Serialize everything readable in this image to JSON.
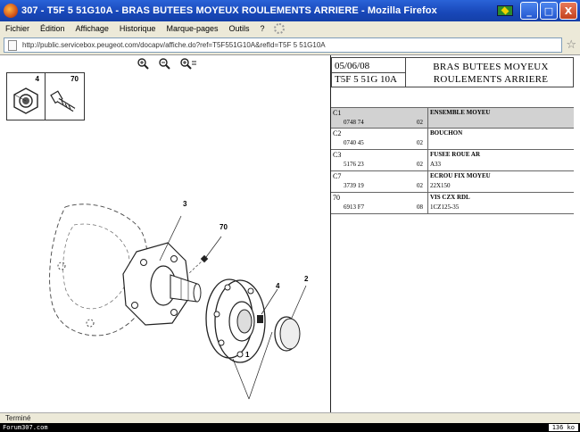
{
  "window": {
    "title": "307 - T5F 5 51G10A - BRAS BUTEES MOYEUX ROULEMENTS ARRIERE - Mozilla Firefox",
    "min_label": "_",
    "max_label": "□",
    "close_label": "X"
  },
  "menu": {
    "items": [
      "Fichier",
      "Édition",
      "Affichage",
      "Historique",
      "Marque-pages",
      "Outils",
      "?"
    ]
  },
  "address": {
    "url": "http://public.servicebox.peugeot.com/docapv/affiche.do?ref=T5F551G10A&refId=T5F 5 51G10A"
  },
  "thumbnails": [
    {
      "number": "4",
      "icon": "nut-icon"
    },
    {
      "number": "70",
      "icon": "screw-icon"
    }
  ],
  "diagram": {
    "callouts": [
      "3",
      "70",
      "4",
      "2",
      "1"
    ]
  },
  "header": {
    "date": "05/06/08",
    "code": "T5F 5 51G 10A",
    "title_line1": "BRAS BUTEES MOYEUX",
    "title_line2": "ROULEMENTS ARRIERE"
  },
  "parts": [
    {
      "ref": "C1",
      "pn": "0748 74",
      "qty": "02",
      "desc": "ENSEMBLE MOYEU",
      "spec": ""
    },
    {
      "ref": "C2",
      "pn": "0740 45",
      "qty": "02",
      "desc": "BOUCHON",
      "spec": ""
    },
    {
      "ref": "C3",
      "pn": "5176 23",
      "qty": "02",
      "desc": "FUSEE ROUE AR",
      "spec": "A33"
    },
    {
      "ref": "C7",
      "pn": "3739 19",
      "qty": "02",
      "desc": "ECROU FIX MOYEU",
      "spec": "22X150"
    },
    {
      "ref": "70",
      "pn": "6913 F7",
      "qty": "08",
      "desc": "VIS CZX RDL",
      "spec": "1CZ125-35"
    }
  ],
  "status": {
    "text": "Terminé"
  },
  "footer": {
    "left": "Forum307.com",
    "right": "136 ko"
  },
  "colors": {
    "titlebar": "#1847b8",
    "chrome": "#ece9d8",
    "highlight_row": "#d2d2d2"
  }
}
